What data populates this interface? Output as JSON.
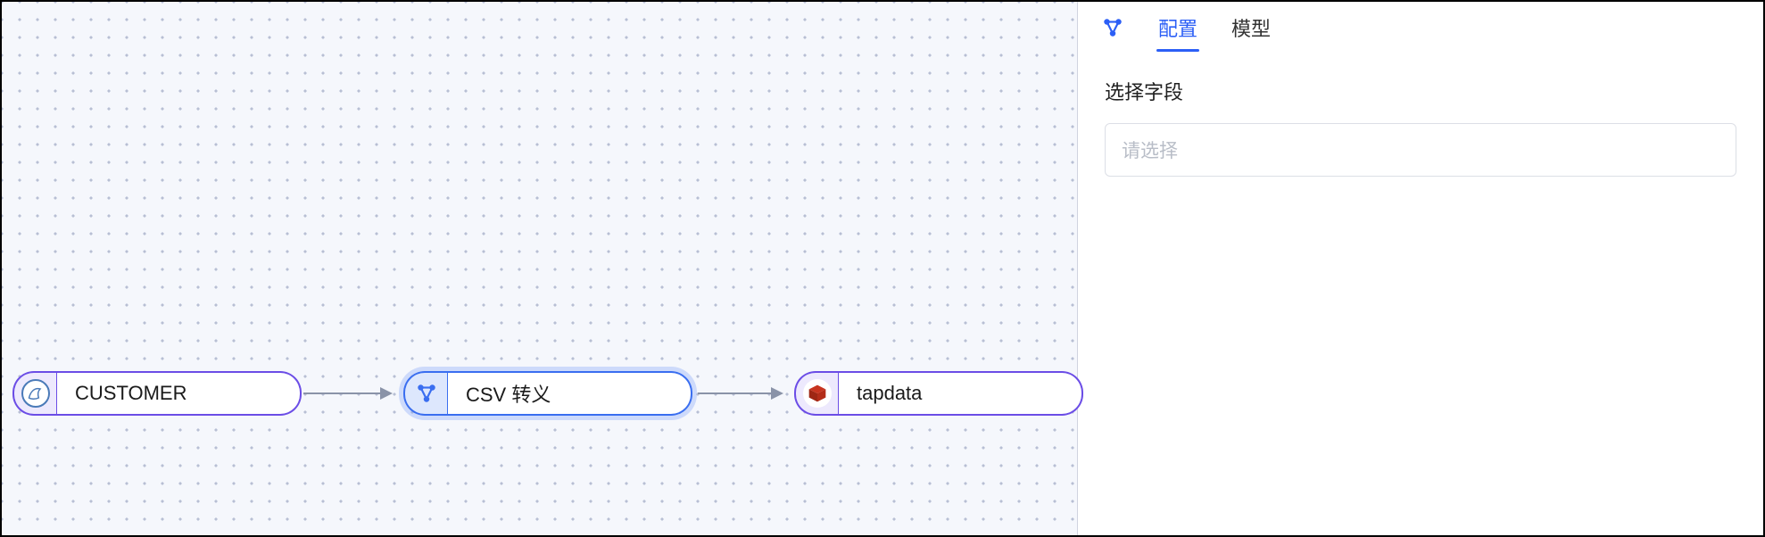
{
  "canvas": {
    "nodes": {
      "source": {
        "label": "CUSTOMER",
        "icon": "mysql-icon"
      },
      "transform": {
        "label": "CSV 转义",
        "icon": "transform-icon"
      },
      "target": {
        "label": "tapdata",
        "icon": "redis-icon"
      }
    }
  },
  "sidebar": {
    "tabs": {
      "config": "配置",
      "model": "模型"
    },
    "panel": {
      "field_label": "选择字段",
      "select_placeholder": "请选择"
    }
  }
}
